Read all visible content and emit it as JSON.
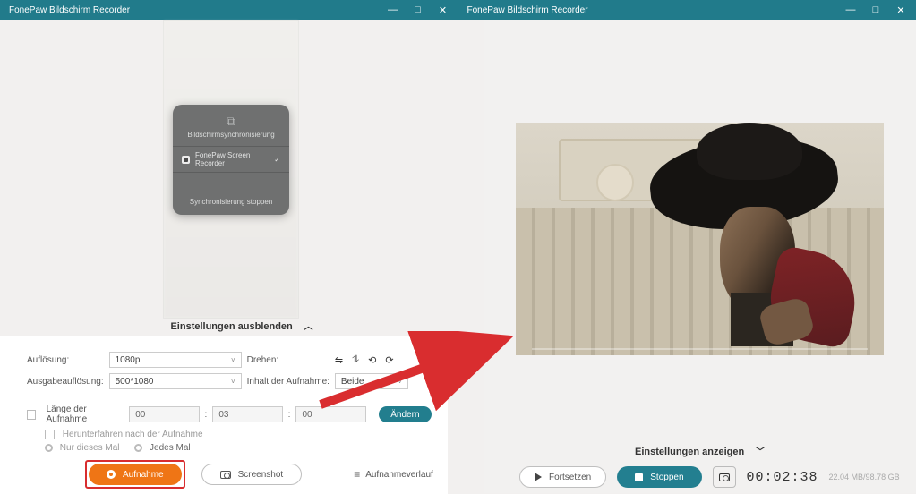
{
  "titlebar": {
    "app_title": "FonePaw Bildschirm Recorder"
  },
  "phone": {
    "sync_title": "Bildschirmsynchronisierung",
    "recorder_label": "FonePaw Screen Recorder",
    "stop_sync": "Synchronisierung stoppen"
  },
  "hide_settings": "Einstellungen ausblenden",
  "settings": {
    "resolution_label": "Auflösung:",
    "resolution_value": "1080p",
    "output_label": "Ausgabeauflösung:",
    "output_value": "500*1080",
    "rotate_label": "Drehen:",
    "content_label": "Inhalt der Aufnahme:",
    "content_value": "Beide",
    "length_label": "Länge der Aufnahme",
    "time": {
      "h": "00",
      "m": "03",
      "s": "00"
    },
    "change_btn": "Ändern",
    "shutdown_label": "Herunterfahren nach der Aufnahme",
    "only_this": "Nur dieses Mal",
    "every_time": "Jedes Mal"
  },
  "bottom": {
    "record": "Aufnahme",
    "screenshot": "Screenshot",
    "history": "Aufnahmeverlauf"
  },
  "right": {
    "show_settings": "Einstellungen anzeigen",
    "resume": "Fortsetzen",
    "stop": "Stoppen",
    "timer": "00:02:38",
    "storage": "22.04 MB/98.78 GB"
  }
}
